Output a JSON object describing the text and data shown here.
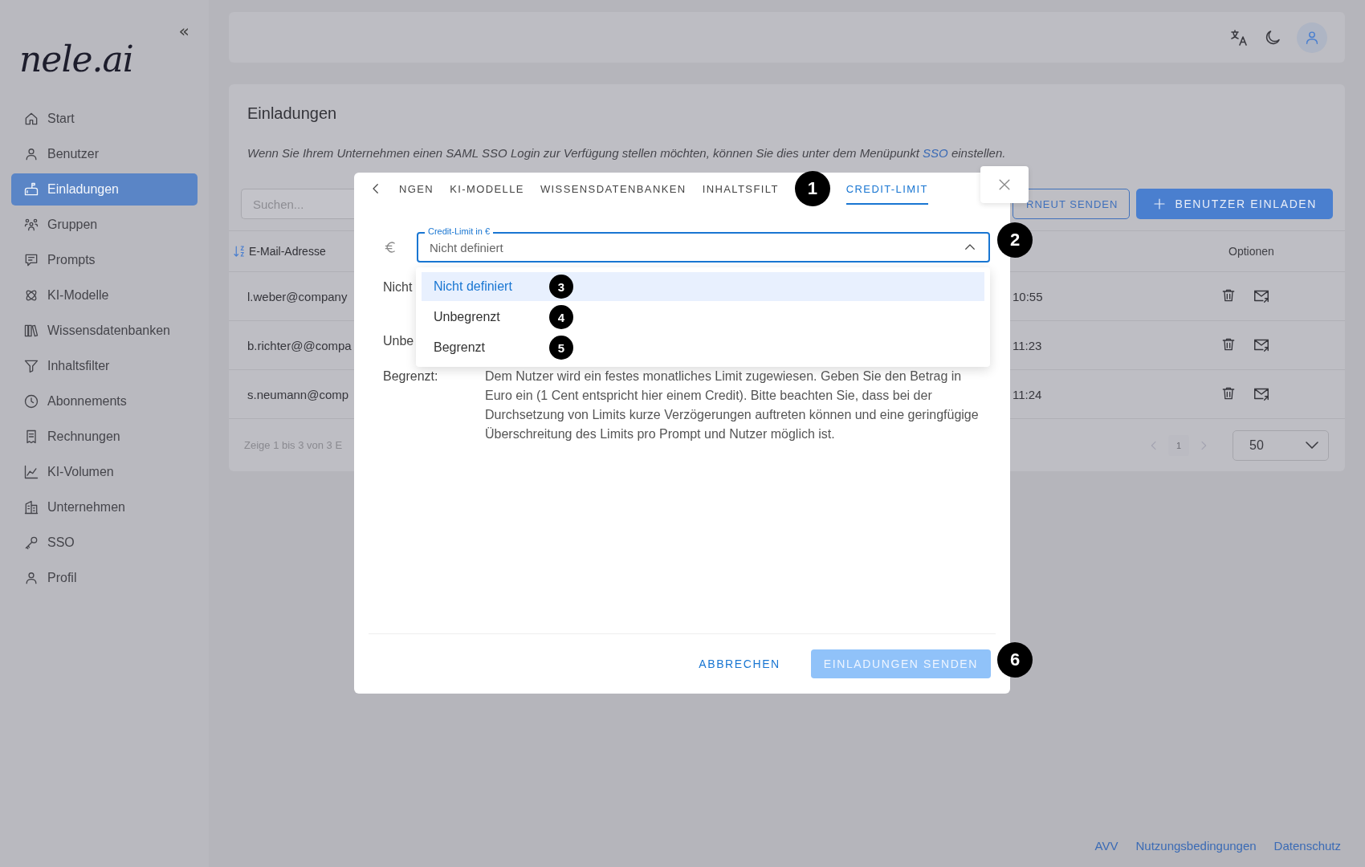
{
  "sidebar": {
    "logo": "nele.ai",
    "collapse": "«",
    "items": [
      {
        "label": "Start",
        "selected": false
      },
      {
        "label": "Benutzer",
        "selected": false
      },
      {
        "label": "Einladungen",
        "selected": true
      },
      {
        "label": "Gruppen",
        "selected": false
      },
      {
        "label": "Prompts",
        "selected": false
      },
      {
        "label": "KI-Modelle",
        "selected": false
      },
      {
        "label": "Wissensdatenbanken",
        "selected": false
      },
      {
        "label": "Inhaltsfilter",
        "selected": false
      },
      {
        "label": "Abonnements",
        "selected": false
      },
      {
        "label": "Rechnungen",
        "selected": false
      },
      {
        "label": "KI-Volumen",
        "selected": false
      },
      {
        "label": "Unternehmen",
        "selected": false
      },
      {
        "label": "SSO",
        "selected": false
      },
      {
        "label": "Profil",
        "selected": false
      }
    ]
  },
  "page": {
    "title": "Einladungen",
    "notice": {
      "before": "Wenn Sie Ihrem Unternehmen einen SAML SSO Login zur Verfügung stellen möchten, können Sie dies unter dem Menüpunkt ",
      "link": "SSO",
      "after": " einstellen."
    },
    "search": {
      "placeholder": "Suchen..."
    },
    "buttons": [
      {
        "label": "RNEUT SENDEN",
        "kind": "outline"
      },
      {
        "label": "BENUTZER EINLADEN",
        "kind": "primary"
      }
    ],
    "table": {
      "columns": [
        {
          "label": "E-Mail-Adresse",
          "sorted": true
        },
        {
          "label": "Optionen",
          "sorted": false
        }
      ],
      "rows": [
        {
          "email": "l.weber@company",
          "column_3": "10:55"
        },
        {
          "email": "b.richter@@compa",
          "column_3": "11:23"
        },
        {
          "email": "s.neumann@comp",
          "column_3": "11:24"
        }
      ]
    },
    "summary": "Zeige 1 bis 3 von 3 E",
    "pagination": {
      "page": "1"
    },
    "page_size": "50"
  },
  "footer_links": [
    "AVV",
    "Nutzungsbedingungen",
    "Datenschutz"
  ],
  "modal": {
    "tabs": [
      {
        "label": "NGEN",
        "selected": false
      },
      {
        "label": "KI-MODELLE",
        "selected": false
      },
      {
        "label": "WISSENSDATENBANKEN",
        "selected": false
      },
      {
        "label": "INHALTSFILT",
        "selected": false
      },
      {
        "label": "CREDIT-LIMIT",
        "selected": true
      }
    ],
    "select": {
      "label": "Credit-Limit in €",
      "value": "Nicht definiert",
      "expanded": true
    },
    "options": [
      {
        "label": "Nicht definiert",
        "selected": true
      },
      {
        "label": "Unbegrenzt",
        "selected": false
      },
      {
        "label": "Begrenzt",
        "selected": false
      }
    ],
    "descriptions": [
      {
        "label": "Nicht"
      },
      {
        "label": "Unbe"
      },
      {
        "label": "Begrenzt:",
        "text": "Dem Nutzer wird ein festes monatliches Limit zugewiesen. Geben Sie den Betrag in Euro ein (1 Cent entspricht hier einem Credit). Bitte beachten Sie, dass bei der Durchsetzung von Limits kurze Verzögerungen auftreten können und eine geringfügige Überschreitung des Limits pro Prompt und Nutzer möglich ist."
      }
    ],
    "actions": [
      {
        "label": "ABBRECHEN",
        "kind": "text",
        "disabled": false
      },
      {
        "label": "EINLADUNGEN SENDEN",
        "kind": "primary",
        "disabled": true
      }
    ]
  },
  "annotations": [
    "1",
    "2",
    "3",
    "4",
    "5",
    "6"
  ]
}
